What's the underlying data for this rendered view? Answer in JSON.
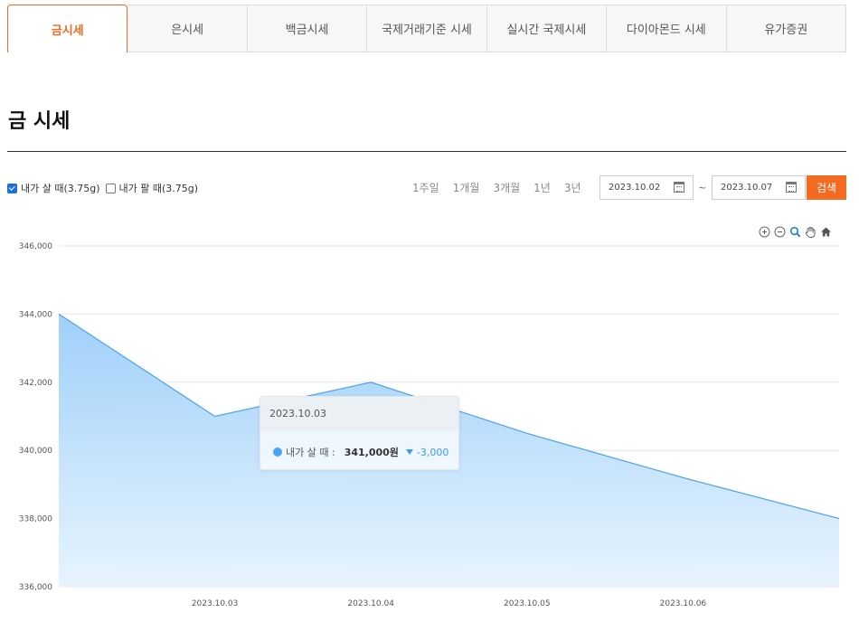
{
  "tabs": [
    {
      "label": "금시세",
      "active": true
    },
    {
      "label": "은시세",
      "active": false
    },
    {
      "label": "백금시세",
      "active": false
    },
    {
      "label": "국제거래기준 시세",
      "active": false
    },
    {
      "label": "실시간 국제시세",
      "active": false
    },
    {
      "label": "다이아몬드 시세",
      "active": false
    },
    {
      "label": "유가증권",
      "active": false
    }
  ],
  "page_title": "금 시세",
  "legend": {
    "buy_label": "내가 살 때(3.75g)",
    "buy_checked": true,
    "sell_label": "내가 팔 때(3.75g)",
    "sell_checked": false
  },
  "ranges": [
    "1주일",
    "1개월",
    "3개월",
    "1년",
    "3년"
  ],
  "date_from": "2023.10.02",
  "date_separator": "~",
  "date_to": "2023.10.07",
  "search_label": "검색",
  "toolbar_icons": [
    "zoom-in-icon",
    "zoom-out-icon",
    "magnifier-icon",
    "pan-hand-icon",
    "home-icon"
  ],
  "tooltip": {
    "date": "2023.10.03",
    "series_label": "내가 살 때 :",
    "value": "341,000원",
    "change": "-3,000"
  },
  "colors": {
    "accent": "#f26b21",
    "series": "#4aa3f0",
    "fill_top": "#9fd0fa",
    "fill_bottom": "#e8f4fe"
  },
  "chart_data": {
    "type": "area",
    "x": [
      "2023.10.02",
      "2023.10.03",
      "2023.10.04",
      "2023.10.05",
      "2023.10.06",
      "2023.10.07"
    ],
    "x_tick_labels": [
      "2023.10.03",
      "2023.10.04",
      "2023.10.05",
      "2023.10.06"
    ],
    "series": [
      {
        "name": "내가 살 때(3.75g)",
        "values": [
          344000,
          341000,
          342000,
          340500,
          339200,
          338000
        ]
      }
    ],
    "y_ticks": [
      "346,000",
      "344,000",
      "342,000",
      "340,000",
      "338,000",
      "336,000"
    ],
    "ylim": [
      336000,
      346000
    ],
    "grid": true
  }
}
